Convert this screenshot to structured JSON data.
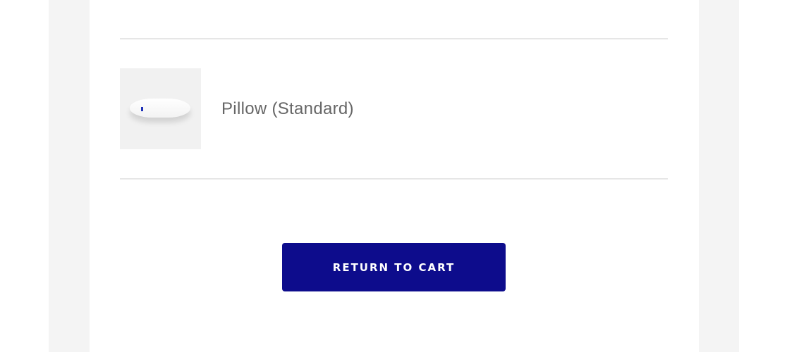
{
  "cart_items": [
    {
      "name": "Pillow (Standard)",
      "thumbnail_icon": "pillow-image"
    }
  ],
  "return_button": {
    "label": "RETURN TO CART"
  },
  "colors": {
    "page_background": "#ffffff",
    "side_panel": "#f4f4f4",
    "divider": "#e6e6e6",
    "button_bg": "#0d0c8c",
    "button_text": "#ffffff",
    "product_text": "#666666"
  }
}
